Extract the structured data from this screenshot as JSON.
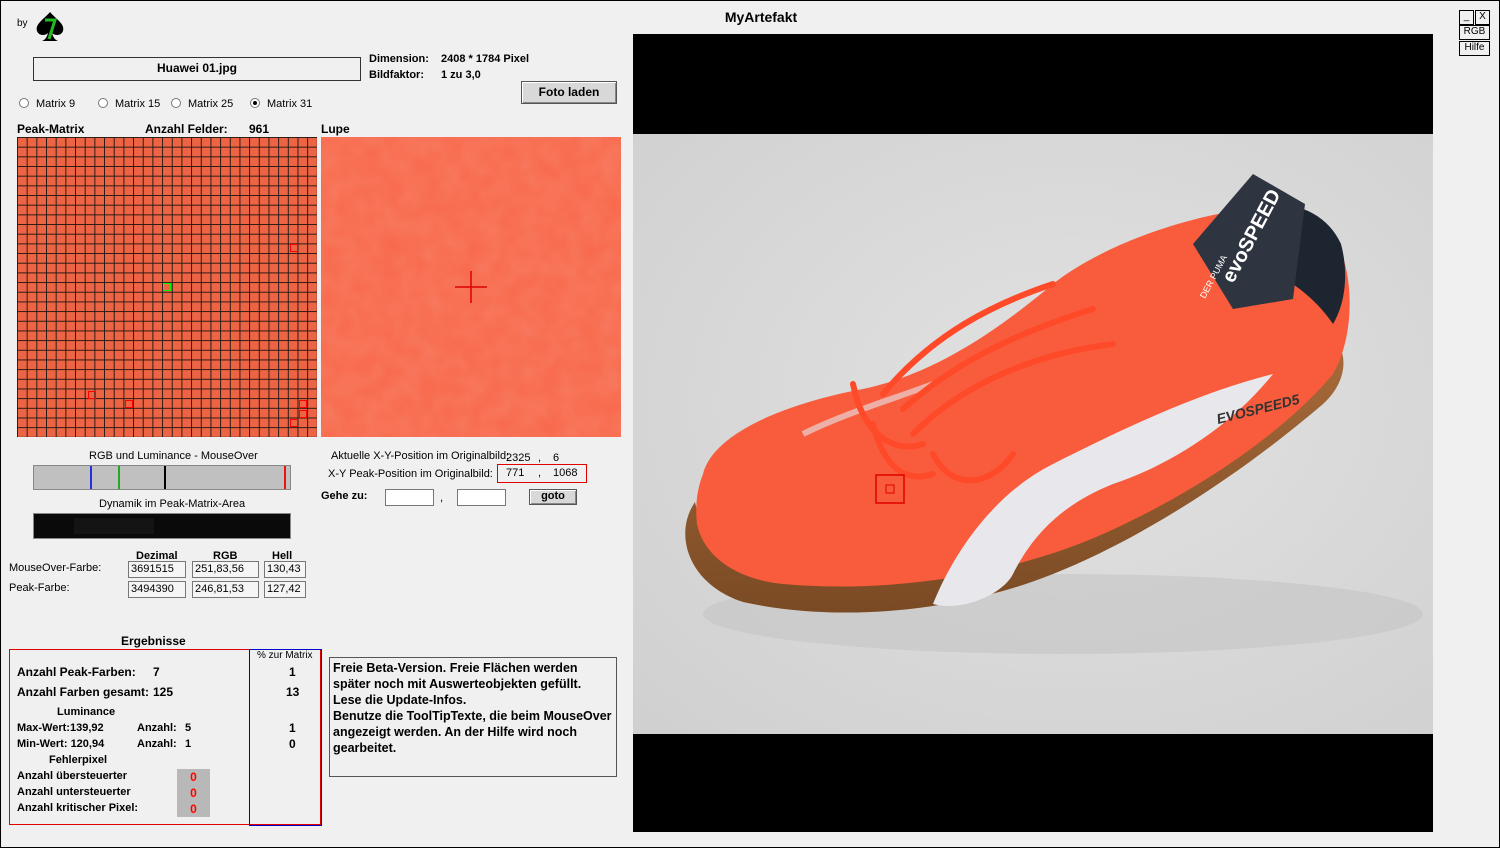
{
  "app": {
    "title": "MyArtefakt",
    "by_label": "by"
  },
  "window_buttons": {
    "minimize": "_",
    "close": "X",
    "rgb": "RGB",
    "help": "Hilfe"
  },
  "file": {
    "name": "Huawei 01.jpg",
    "dimension_label": "Dimension:",
    "dimension_value": "2408 * 1784 Pixel",
    "bildfaktor_label": "Bildfaktor:",
    "bildfaktor_value": "1 zu 3,0",
    "load_button": "Foto laden"
  },
  "matrix_options": [
    {
      "label": "Matrix 9",
      "selected": false
    },
    {
      "label": "Matrix 15",
      "selected": false
    },
    {
      "label": "Matrix 25",
      "selected": false
    },
    {
      "label": "Matrix 31",
      "selected": true
    }
  ],
  "peak_matrix": {
    "title": "Peak-Matrix",
    "fields_label": "Anzahl Felder:",
    "fields_value": "961",
    "grid_size": 31
  },
  "lupe": {
    "title": "Lupe"
  },
  "rgb_bar": {
    "label": "RGB und Luminance - MouseOver",
    "blue": 0.22,
    "green": 0.33,
    "luminance": 0.51,
    "red": 0.985
  },
  "dynamik": {
    "label": "Dynamik im Peak-Matrix-Area"
  },
  "position": {
    "current_label": "Aktuelle X-Y-Position  im Originalbild:",
    "current_x": "2325",
    "current_y": "6",
    "peak_label": "X-Y Peak-Position  im Originalbild:",
    "peak_x": "771",
    "peak_y": "1068",
    "separator": ",",
    "goto_label": "Gehe zu:",
    "goto_x": "",
    "goto_y": "",
    "goto_button": "goto"
  },
  "colors": {
    "headers": [
      "Dezimal",
      "RGB",
      "Hell"
    ],
    "mouseover": {
      "label": "MouseOver-Farbe:",
      "decimal": "3691515",
      "rgb": "251,83,56",
      "bright": "130,43"
    },
    "peak": {
      "label": "Peak-Farbe:",
      "decimal": "3494390",
      "rgb": "246,81,53",
      "bright": "127,42"
    }
  },
  "results": {
    "title": "Ergebnisse",
    "pct_header": "% zur Matrix",
    "peak_colors_label": "Anzahl Peak-Farben:",
    "peak_colors_value": "7",
    "peak_colors_pct": "1",
    "total_colors_label": "Anzahl Farben gesamt:",
    "total_colors_value": "125",
    "total_colors_pct": "13",
    "luminance_title": "Luminance",
    "max_label": "Max-Wert:139,92",
    "max_count_label": "Anzahl:",
    "max_count": "5",
    "max_pct": "1",
    "min_label": "Min-Wert: 120,94",
    "min_count_label": "Anzahl:",
    "min_count": "1",
    "min_pct": "0",
    "error_title": "Fehlerpixel",
    "over_label": "Anzahl übersteuerter",
    "over_value": "0",
    "under_label": "Anzahl untersteuerter",
    "under_value": "0",
    "critical_label": "Anzahl kritischer Pixel:",
    "critical_value": "0"
  },
  "info_text": "Freie Beta-Version. Freie Flächen werden später noch mit Auswerteobjekten gefüllt. Lese die Update-Infos.\nBenutze die ToolTipTexte, die beim MouseOver angezeigt werden. An der Hilfe wird noch gearbeitet.",
  "shoe": {
    "tag_brand": "PUMA",
    "tag_model": "evoSPEED",
    "tag_line": "DER PUMA",
    "side_text": "EVOSPEED5"
  }
}
